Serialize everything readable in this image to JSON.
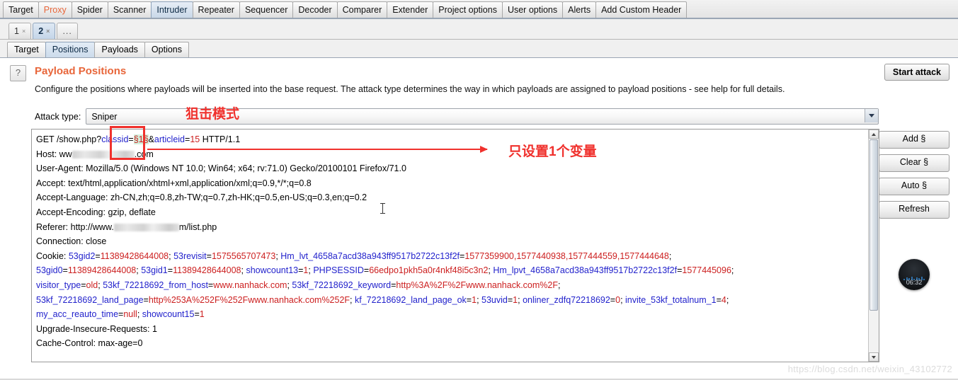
{
  "main_tabs": [
    {
      "label": "Target",
      "state": "normal"
    },
    {
      "label": "Proxy",
      "state": "proxy"
    },
    {
      "label": "Spider",
      "state": "normal"
    },
    {
      "label": "Scanner",
      "state": "normal"
    },
    {
      "label": "Intruder",
      "state": "active"
    },
    {
      "label": "Repeater",
      "state": "normal"
    },
    {
      "label": "Sequencer",
      "state": "normal"
    },
    {
      "label": "Decoder",
      "state": "normal"
    },
    {
      "label": "Comparer",
      "state": "normal"
    },
    {
      "label": "Extender",
      "state": "normal"
    },
    {
      "label": "Project options",
      "state": "normal"
    },
    {
      "label": "User options",
      "state": "normal"
    },
    {
      "label": "Alerts",
      "state": "normal"
    },
    {
      "label": "Add Custom Header",
      "state": "normal"
    }
  ],
  "attack_tabs": [
    {
      "label": "1",
      "close": "×",
      "active": false
    },
    {
      "label": "2",
      "close": "×",
      "active": true
    },
    {
      "label": "...",
      "active": false
    }
  ],
  "inner_tabs": [
    {
      "label": "Target",
      "active": false
    },
    {
      "label": "Positions",
      "active": true
    },
    {
      "label": "Payloads",
      "active": false
    },
    {
      "label": "Options",
      "active": false
    }
  ],
  "panel": {
    "help_icon": "?",
    "title": "Payload Positions",
    "description": "Configure the positions where payloads will be inserted into the base request. The attack type determines the way in which payloads are assigned to payload positions - see help for full details.",
    "start_attack_label": "Start attack",
    "attack_type_label": "Attack type:",
    "attack_type_value": "Sniper"
  },
  "side_buttons": [
    {
      "label": "Add §"
    },
    {
      "label": "Clear §"
    },
    {
      "label": "Auto §"
    },
    {
      "label": "Refresh"
    }
  ],
  "clock": {
    "time": "06:32"
  },
  "request": {
    "line1": {
      "method_path": "GET /show.php?",
      "param1_key": "classid",
      "eq": "=",
      "marker": "§1§",
      "amp": "&",
      "param2_key": "articleid",
      "param2_val": "15",
      "protocol": " HTTP/1.1"
    },
    "line_host_prefix": "Host: ww",
    "line_host_suffix": ".com",
    "line_useragent": "User-Agent: Mozilla/5.0 (Windows NT 10.0; Win64; x64; rv:71.0) Gecko/20100101 Firefox/71.0",
    "line_accept": "Accept: text/html,application/xhtml+xml,application/xml;q=0.9,*/*;q=0.8",
    "line_accept_language": "Accept-Language: zh-CN,zh;q=0.8,zh-TW;q=0.7,zh-HK;q=0.5,en-US;q=0.3,en;q=0.2",
    "line_accept_encoding": "Accept-Encoding: gzip, deflate",
    "line_referer_prefix": "Referer: http://www.",
    "line_referer_suffix": "m/list.php",
    "line_connection": "Connection: close",
    "cookie_label": "Cookie: ",
    "cookies": [
      {
        "k": "53gid2",
        "v": "11389428644008",
        "sep": "; "
      },
      {
        "k": "53revisit",
        "v": "1575565707473",
        "sep": "; "
      },
      {
        "k": "Hm_lvt_4658a7acd38a943ff9517b2722c13f2f",
        "v": "1577359900,1577440938,1577444559,1577444648",
        "sep": ";"
      },
      {
        "k": "53gid0",
        "v": "11389428644008",
        "sep": "; ",
        "newline": true
      },
      {
        "k": "53gid1",
        "v": "11389428644008",
        "sep": "; "
      },
      {
        "k": "showcount13",
        "v": "1",
        "sep": "; "
      },
      {
        "k": "PHPSESSID",
        "v": "66edpo1pkh5a0r4nkf48i5c3n2",
        "sep": "; "
      },
      {
        "k": "Hm_lpvt_4658a7acd38a943ff9517b2722c13f2f",
        "v": "1577445096",
        "sep": ";"
      },
      {
        "k": "visitor_type",
        "v": "old",
        "sep": "; ",
        "newline": true
      },
      {
        "k": "53kf_72218692_from_host",
        "v": "www.nanhack.com",
        "sep": "; "
      },
      {
        "k": "53kf_72218692_keyword",
        "v": "http%3A%2F%2Fwww.nanhack.com%2F",
        "sep": ";"
      },
      {
        "k": "53kf_72218692_land_page",
        "v": "http%253A%252F%252Fwww.nanhack.com%252F",
        "sep": "; ",
        "newline": true
      },
      {
        "k": "kf_72218692_land_page_ok",
        "v": "1",
        "sep": "; "
      },
      {
        "k": "53uvid",
        "v": "1",
        "sep": "; "
      },
      {
        "k": "onliner_zdfq72218692",
        "v": "0",
        "sep": "; "
      },
      {
        "k": "invite_53kf_totalnum_1",
        "v": "4",
        "sep": ";"
      },
      {
        "k": "my_acc_reauto_time",
        "v": "null",
        "sep": "; ",
        "newline": true
      },
      {
        "k": "showcount15",
        "v": "1",
        "sep": ""
      }
    ],
    "line_upgrade": "Upgrade-Insecure-Requests: 1",
    "line_cache": "Cache-Control: max-age=0"
  },
  "annotations": {
    "attack_type_note": "狙击模式",
    "single_variable_note": "只设置1个变量",
    "accent_color": "#f0312d"
  },
  "watermark": "https://blog.csdn.net/weixin_43102772"
}
